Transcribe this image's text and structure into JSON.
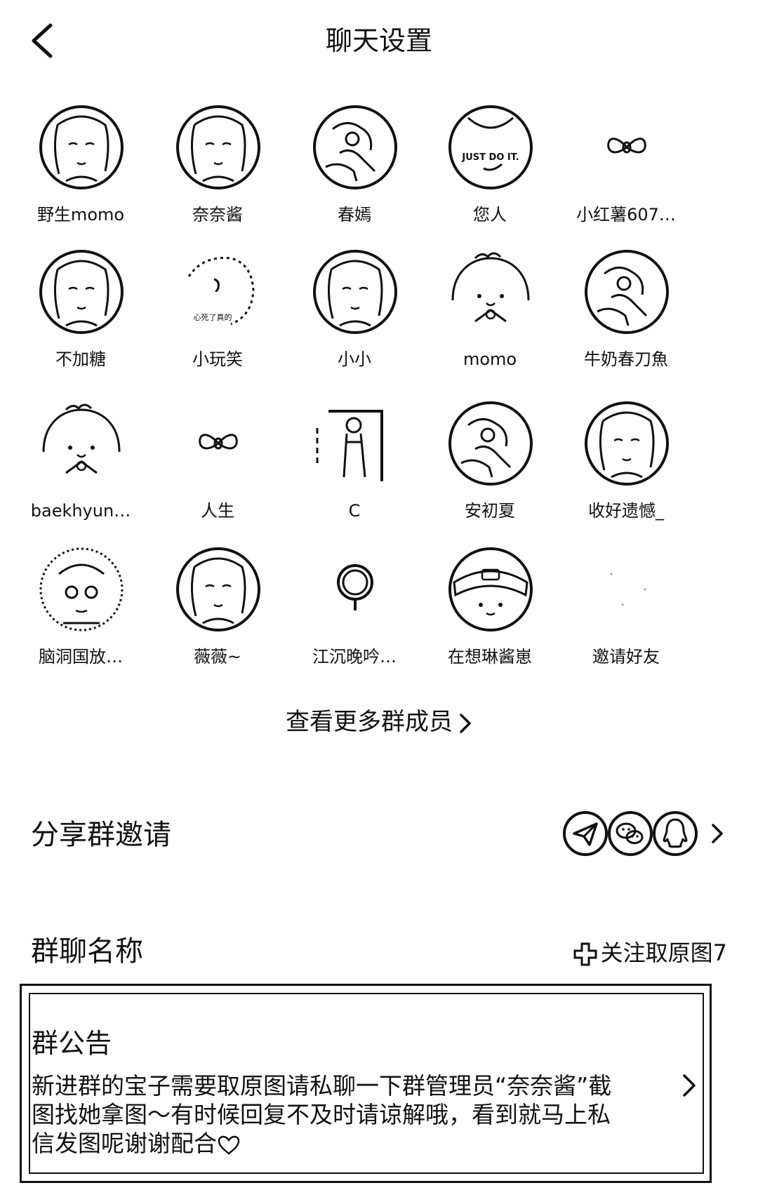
{
  "header": {
    "title": "聊天设置"
  },
  "members": [
    {
      "name": "野生momo",
      "avatar": "girl-portrait"
    },
    {
      "name": "奈奈酱",
      "avatar": "girl-portrait"
    },
    {
      "name": "春嫣",
      "avatar": "photo"
    },
    {
      "name": "您人",
      "avatar": "just-do-it-shirt"
    },
    {
      "name": "小红薯607…",
      "avatar": "bow"
    },
    {
      "name": "不加糖",
      "avatar": "girl-portrait"
    },
    {
      "name": "小玩笑",
      "avatar": "cartoon"
    },
    {
      "name": "小小",
      "avatar": "girl-portrait"
    },
    {
      "name": "momo",
      "avatar": "cute-cartoon"
    },
    {
      "name": "牛奶春刀魚",
      "avatar": "photo"
    },
    {
      "name": "baekhyun…",
      "avatar": "cute-cartoon"
    },
    {
      "name": "人生",
      "avatar": "bow"
    },
    {
      "name": "C",
      "avatar": "mirror-selfie"
    },
    {
      "name": "安初夏",
      "avatar": "photo"
    },
    {
      "name": "收好遗憾_",
      "avatar": "girl-portrait"
    },
    {
      "name": "脑洞国放…",
      "avatar": "anime-girl"
    },
    {
      "name": "薇薇~",
      "avatar": "girl-portrait"
    },
    {
      "name": "江沉晚吟…",
      "avatar": "ring"
    },
    {
      "name": "在想琳酱崽",
      "avatar": "cartoon-hat"
    },
    {
      "name": "邀请好友",
      "avatar": "blank"
    }
  ],
  "avatar_caption": "心死了真的",
  "avatar_shirt_text": "JUST DO IT.",
  "more_members": "查看更多群成员",
  "share": {
    "label": "分享群邀请",
    "icons": [
      "send-icon",
      "wechat-icon",
      "qq-icon"
    ]
  },
  "group_name": {
    "label": "群聊名称",
    "value": "关注取原图7"
  },
  "notice": {
    "title": "群公告",
    "text": "新进群的宝子需要取原图请私聊一下群管理员“奈奈酱”截图找她拿图～有时候回复不及时请谅解哦，看到就马上私信发图呢谢谢配合"
  }
}
